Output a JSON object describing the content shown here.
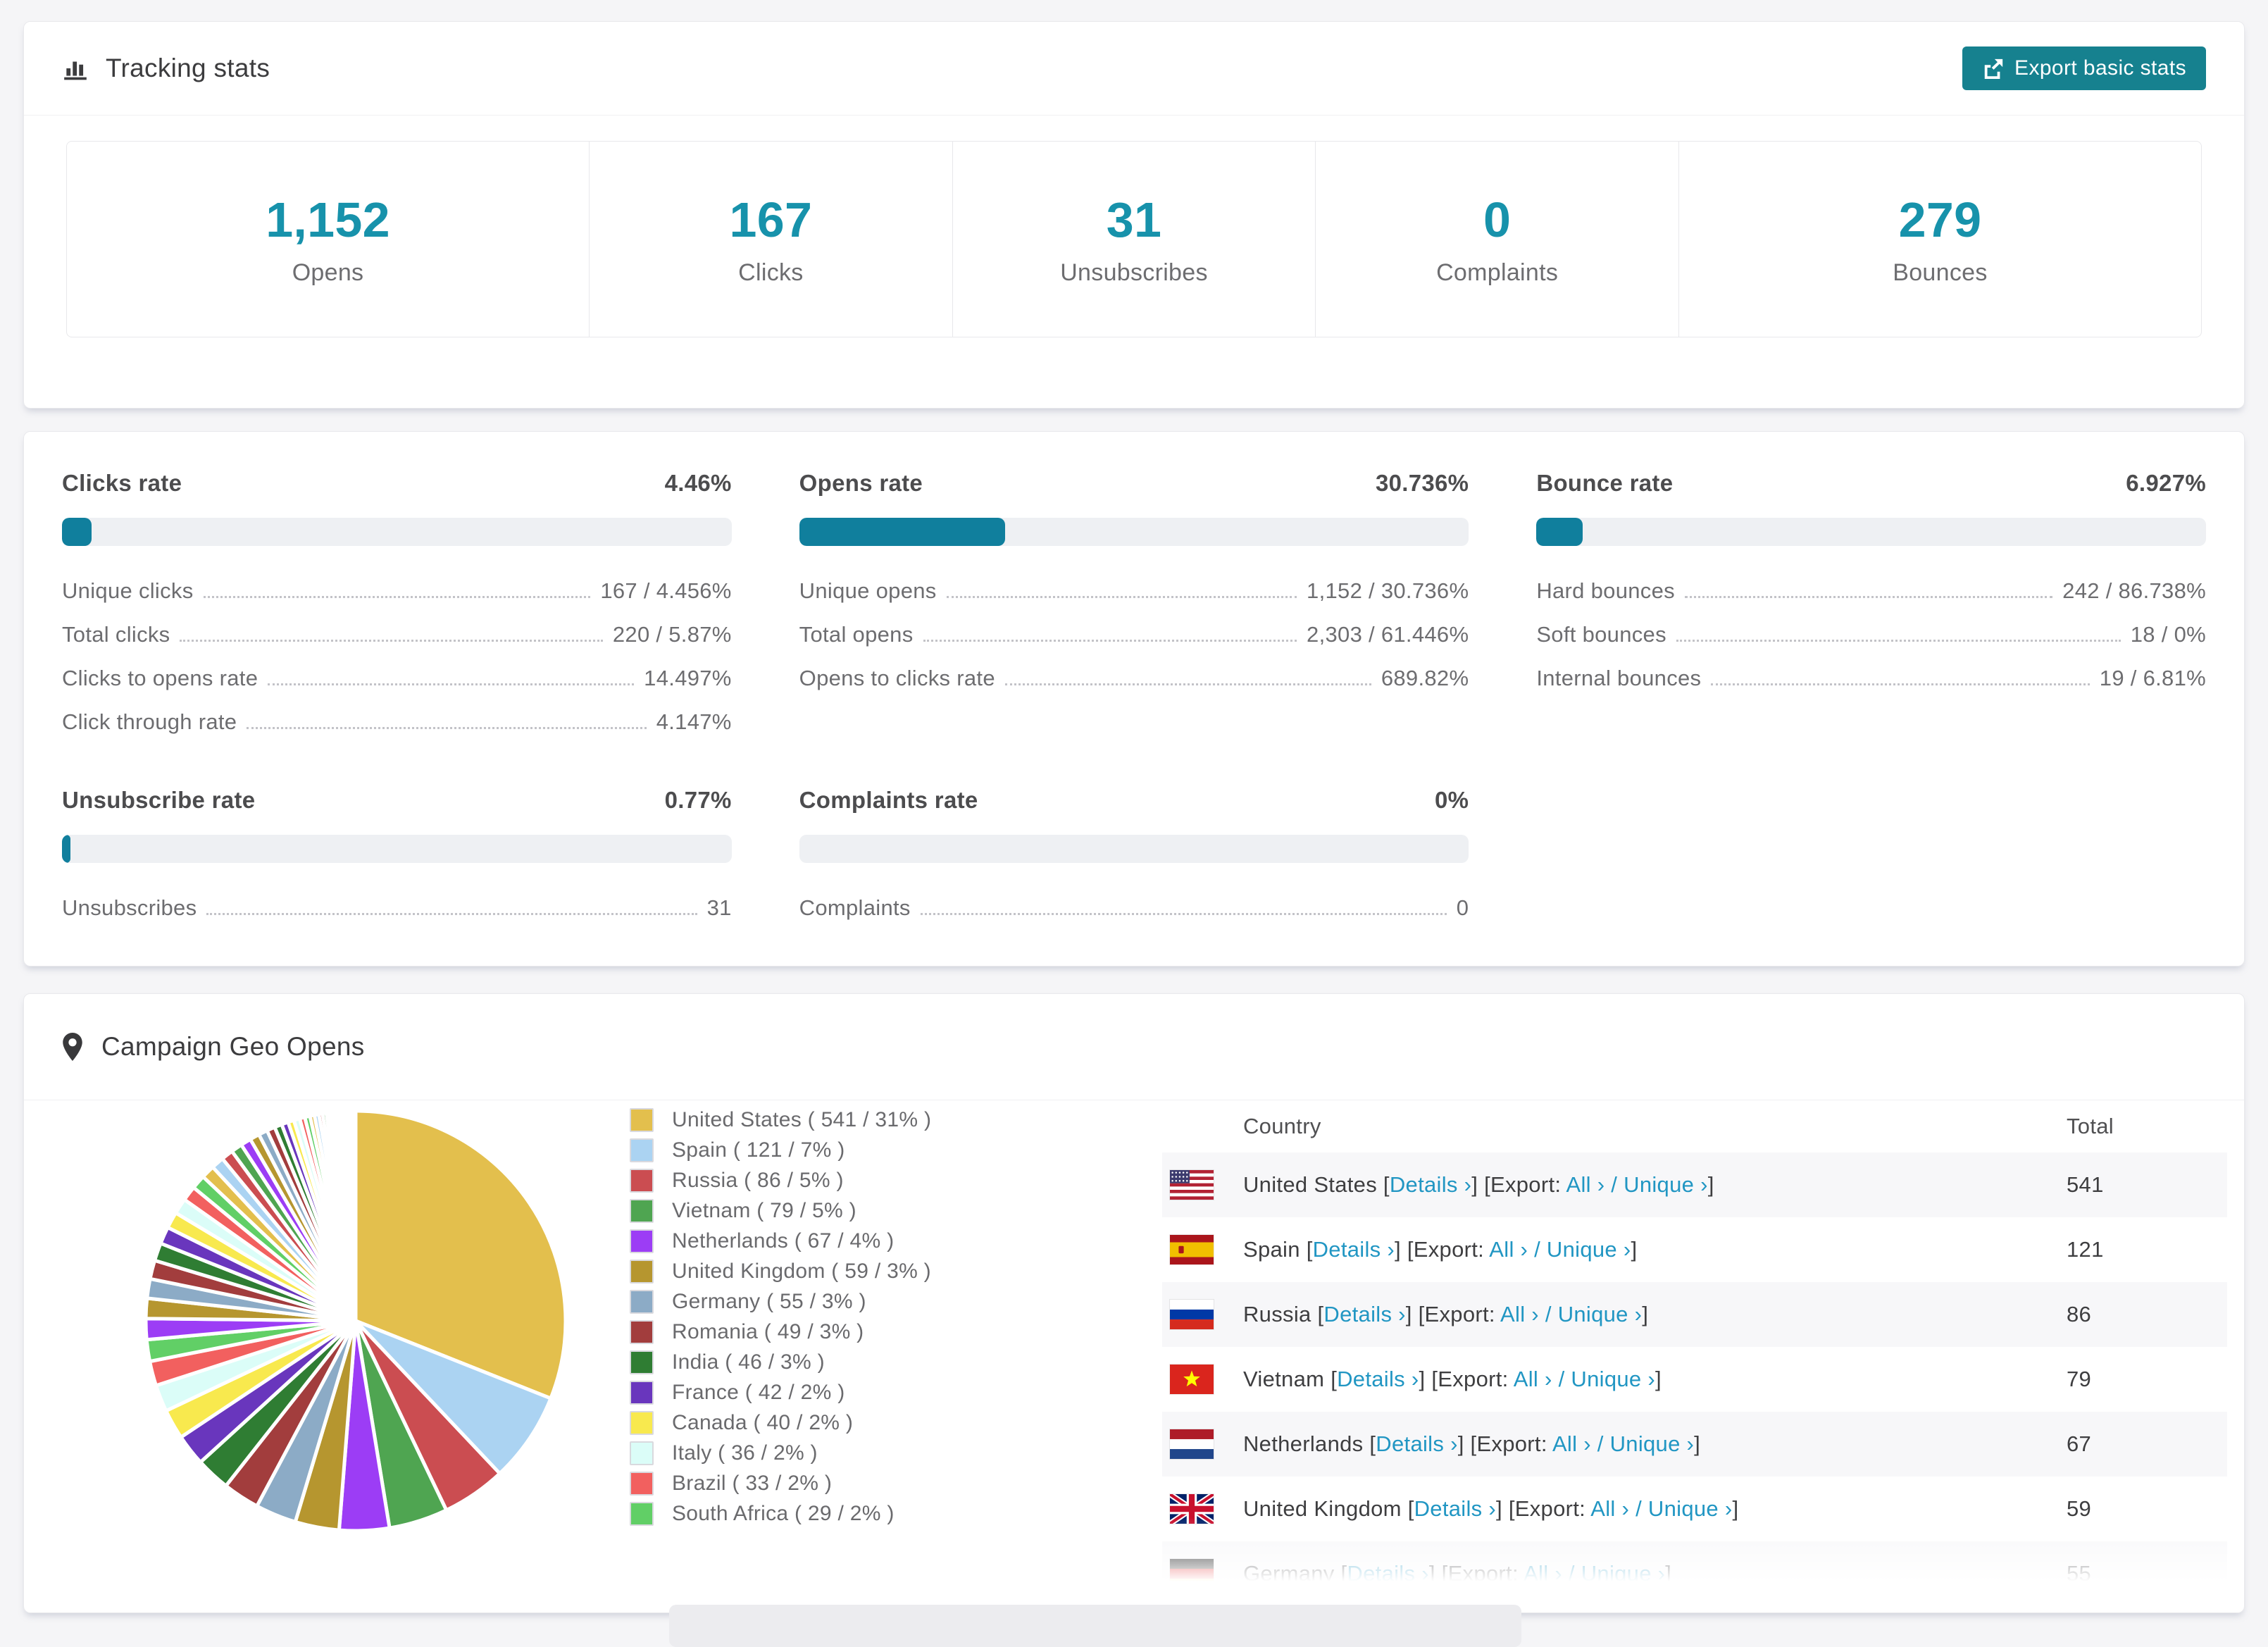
{
  "colors": {
    "accent_number": "#1792ab",
    "button_teal": "#16818f",
    "bar_fill": "#107f9d",
    "link_blue": "#2196c3",
    "page_bg": "#f5f5f7"
  },
  "tracking": {
    "title": "Tracking stats",
    "export_button": "Export basic stats",
    "summary": [
      {
        "value": "1,152",
        "label": "Opens"
      },
      {
        "value": "167",
        "label": "Clicks"
      },
      {
        "value": "31",
        "label": "Unsubscribes"
      },
      {
        "value": "0",
        "label": "Complaints"
      },
      {
        "value": "279",
        "label": "Bounces"
      }
    ]
  },
  "rates": {
    "clicks": {
      "title": "Clicks rate",
      "percent_label": "4.46%",
      "bar_percent": 4.46,
      "rows": [
        {
          "label": "Unique clicks",
          "value": "167 / 4.456%"
        },
        {
          "label": "Total clicks",
          "value": "220 / 5.87%"
        },
        {
          "label": "Clicks to opens rate",
          "value": "14.497%"
        },
        {
          "label": "Click through rate",
          "value": "4.147%"
        }
      ]
    },
    "opens": {
      "title": "Opens rate",
      "percent_label": "30.736%",
      "bar_percent": 30.736,
      "rows": [
        {
          "label": "Unique opens",
          "value": "1,152 / 30.736%"
        },
        {
          "label": "Total opens",
          "value": "2,303 / 61.446%"
        },
        {
          "label": "Opens to clicks rate",
          "value": "689.82%"
        }
      ]
    },
    "bounce": {
      "title": "Bounce rate",
      "percent_label": "6.927%",
      "bar_percent": 6.927,
      "rows": [
        {
          "label": "Hard bounces",
          "value": "242 / 86.738%"
        },
        {
          "label": "Soft bounces",
          "value": "18 / 0%"
        },
        {
          "label": "Internal bounces",
          "value": "19 / 6.81%"
        }
      ]
    },
    "unsubscribe": {
      "title": "Unsubscribe rate",
      "percent_label": "0.77%",
      "bar_percent": 0.77,
      "rows": [
        {
          "label": "Unsubscribes",
          "value": "31"
        }
      ]
    },
    "complaints": {
      "title": "Complaints rate",
      "percent_label": "0%",
      "bar_percent": 0,
      "rows": [
        {
          "label": "Complaints",
          "value": "0"
        }
      ]
    }
  },
  "geo": {
    "title": "Campaign Geo Opens",
    "table_headers": {
      "country": "Country",
      "total": "Total"
    },
    "link_labels": {
      "details": "Details ›",
      "export": "Export:",
      "all": "All ›",
      "slash": "/",
      "unique": "Unique ›"
    },
    "rows": [
      {
        "country": "United States",
        "flag": "us",
        "total": "541"
      },
      {
        "country": "Spain",
        "flag": "es",
        "total": "121"
      },
      {
        "country": "Russia",
        "flag": "ru",
        "total": "86"
      },
      {
        "country": "Vietnam",
        "flag": "vn",
        "total": "79"
      },
      {
        "country": "Netherlands",
        "flag": "nl",
        "total": "67"
      },
      {
        "country": "United Kingdom",
        "flag": "gb",
        "total": "59"
      },
      {
        "country": "Germany",
        "flag": "de",
        "total": "55",
        "partial": true
      }
    ]
  },
  "chart_data": {
    "type": "pie",
    "title": "Campaign Geo Opens",
    "legend_position": "right",
    "start_angle_deg": -90,
    "direction": "clockwise",
    "series": [
      {
        "name": "United States",
        "value": 541,
        "pct": "31%",
        "color": "#e3bf4d"
      },
      {
        "name": "Spain",
        "value": 121,
        "pct": "7%",
        "color": "#abd3f2"
      },
      {
        "name": "Russia",
        "value": 86,
        "pct": "5%",
        "color": "#cb4d51"
      },
      {
        "name": "Vietnam",
        "value": 79,
        "pct": "5%",
        "color": "#4fa551"
      },
      {
        "name": "Netherlands",
        "value": 67,
        "pct": "4%",
        "color": "#9c3df5"
      },
      {
        "name": "United Kingdom",
        "value": 59,
        "pct": "3%",
        "color": "#b6962f"
      },
      {
        "name": "Germany",
        "value": 55,
        "pct": "3%",
        "color": "#8cabc6"
      },
      {
        "name": "Romania",
        "value": 49,
        "pct": "3%",
        "color": "#a23d3d"
      },
      {
        "name": "India",
        "value": 46,
        "pct": "3%",
        "color": "#2f7d33"
      },
      {
        "name": "France",
        "value": 42,
        "pct": "2%",
        "color": "#6936bd"
      },
      {
        "name": "Canada",
        "value": 40,
        "pct": "2%",
        "color": "#f8e94e"
      },
      {
        "name": "Italy",
        "value": 36,
        "pct": "2%",
        "color": "#dbfdf8"
      },
      {
        "name": "Brazil",
        "value": 33,
        "pct": "2%",
        "color": "#f2605f"
      },
      {
        "name": "South Africa",
        "value": 29,
        "pct": "2%",
        "color": "#61cf66"
      }
    ],
    "palette": [
      "#e3bf4d",
      "#abd3f2",
      "#cb4d51",
      "#4fa551",
      "#9c3df5",
      "#b6962f",
      "#8cabc6",
      "#a23d3d",
      "#2f7d33",
      "#6936bd",
      "#f8e94e",
      "#dbfdf8",
      "#f2605f",
      "#61cf66"
    ],
    "palette_cycle_offset": 4,
    "unlabeled_tail_values": [
      28,
      27,
      26,
      25,
      24,
      23,
      22,
      21,
      20,
      19,
      18,
      17,
      16,
      15,
      14,
      13,
      12,
      11,
      10,
      9,
      8,
      8,
      7,
      7,
      6,
      6,
      5,
      5,
      4,
      4,
      3,
      3,
      3,
      3,
      2,
      2,
      2,
      2,
      2,
      1,
      1,
      1,
      1,
      1,
      1,
      1,
      1,
      1
    ]
  }
}
